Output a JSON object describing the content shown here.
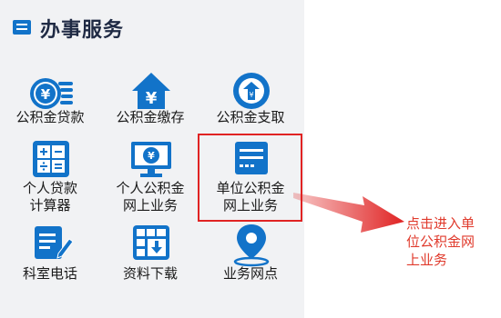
{
  "header": {
    "title": "办事服务"
  },
  "services": [
    {
      "label_lines": [
        "公积金贷款"
      ],
      "icon": "coin-stack-icon"
    },
    {
      "label_lines": [
        "公积金缴存"
      ],
      "icon": "house-yuan-icon"
    },
    {
      "label_lines": [
        "公积金支取"
      ],
      "icon": "withdraw-badge-icon"
    },
    {
      "label_lines": [
        "个人贷款",
        "计算器"
      ],
      "icon": "calculator-icon"
    },
    {
      "label_lines": [
        "个人公积金",
        "网上业务"
      ],
      "icon": "monitor-yuan-icon"
    },
    {
      "label_lines": [
        "单位公积金",
        "网上业务"
      ],
      "icon": "document-card-icon"
    },
    {
      "label_lines": [
        "科室电话"
      ],
      "icon": "notepad-pen-icon"
    },
    {
      "label_lines": [
        "资料下载"
      ],
      "icon": "grid-download-icon"
    },
    {
      "label_lines": [
        "业务网点"
      ],
      "icon": "map-pin-icon"
    }
  ],
  "annotation": {
    "lines": [
      "点击进入单",
      "位公积金网",
      "上业务"
    ]
  },
  "colors": {
    "accent": "#1273c9",
    "panel_bg": "#f1f2f4",
    "highlight": "#e02323",
    "annotation": "#e03a2c"
  }
}
